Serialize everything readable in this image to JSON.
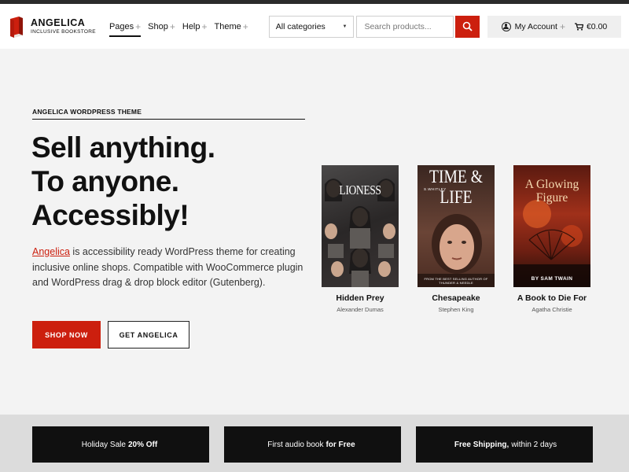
{
  "brand": {
    "name": "ANGELICA",
    "tagline": "INCLUSIVE BOOKSTORE",
    "accent": "#cc1f0e"
  },
  "nav": {
    "items": [
      {
        "label": "Pages",
        "active": true
      },
      {
        "label": "Shop",
        "active": false
      },
      {
        "label": "Help",
        "active": false
      },
      {
        "label": "Theme",
        "active": false
      }
    ],
    "plus_glyph": "+"
  },
  "search": {
    "category_value": "All categories",
    "placeholder": "Search products...",
    "button_icon": "search-icon"
  },
  "account": {
    "label": "My Account",
    "cart_total": "€0.00"
  },
  "hero": {
    "eyebrow": "ANGELICA WORDPRESS THEME",
    "headline_lines": [
      "Sell anything.",
      "To anyone.",
      "Accessibly!"
    ],
    "lead_link": "Angelica",
    "lead_text": " is accessibility ready WordPress theme for creating inclusive online shops. Compatible with WooCommerce plugin and WordPress drag & drop block editor (Gutenberg).",
    "primary_button": "SHOP NOW",
    "secondary_button": "GET ANGELICA"
  },
  "books": [
    {
      "title": "Hidden Prey",
      "author": "Alexander Dumas",
      "cover_text": "LIONESS"
    },
    {
      "title": "Chesapeake",
      "author": "Stephen King",
      "cover_text": "TIME & LIFE",
      "cover_sub": "S.WHITLEY",
      "cover_foot": "FROM THE BEST SELLING AUTHOR OF THUNDER & NEEDLE"
    },
    {
      "title": "A Book to Die For",
      "author": "Agatha Christie",
      "cover_text": "A Glowing Figure",
      "cover_sub": "BY SAM TWAIN"
    }
  ],
  "promos": [
    {
      "pre": "Holiday Sale ",
      "bold": "20% Off",
      "post": ""
    },
    {
      "pre": "First audio book ",
      "bold": "for Free",
      "post": ""
    },
    {
      "pre": "",
      "bold": "Free Shipping,",
      "post": " within 2 days"
    }
  ]
}
